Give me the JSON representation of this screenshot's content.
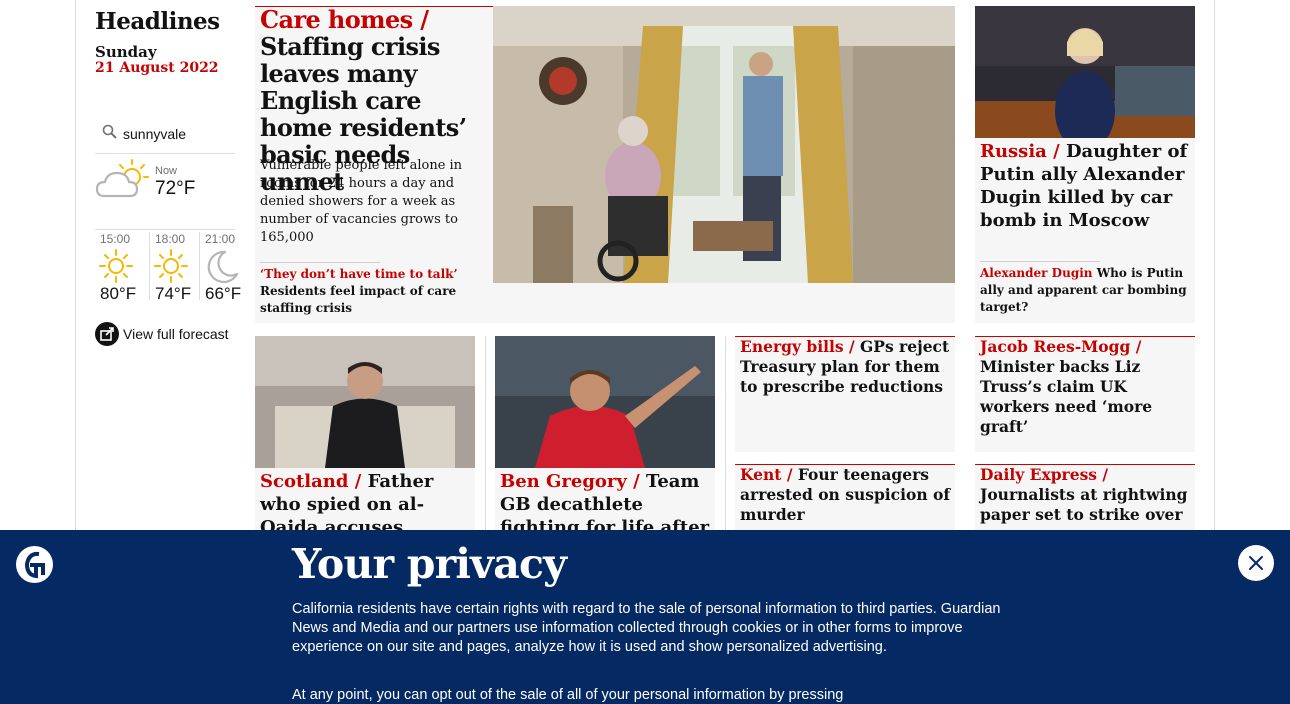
{
  "sidebar": {
    "section_title": "Headlines",
    "day": "Sunday",
    "date": "21 August 2022",
    "weather": {
      "location": "sunnyvale",
      "now_label": "Now",
      "now_temp": "72°F",
      "now_icon": "partly-cloudy-icon",
      "forecast": [
        {
          "time": "15:00",
          "temp": "80°F",
          "icon": "sun-icon"
        },
        {
          "time": "18:00",
          "temp": "74°F",
          "icon": "sun-icon"
        },
        {
          "time": "21:00",
          "temp": "66°F",
          "icon": "moon-icon"
        }
      ],
      "full_forecast_label": "View full forecast"
    }
  },
  "main_story": {
    "kicker": "Care homes /",
    "headline": "Staffing crisis leaves many English care home residents’ basic needs unmet",
    "standfirst": "Vulnerable people left alone in rooms for 24 hours a day and denied showers for a week as number of vacancies grows to 165,000",
    "sublink_kicker": "‘They don’t have time to talk’",
    "sublink_text": "Residents feel impact of care staffing crisis"
  },
  "russia_story": {
    "kicker": "Russia /",
    "headline": "Daughter of Putin ally Alexander Dugin killed by car bomb in Moscow",
    "sublink_kicker": "Alexander Dugin",
    "sublink_text": "Who is Putin ally and apparent car bombing target?"
  },
  "scotland_story": {
    "kicker": "Scotland /",
    "headline": "Father who spied on al-Qaida accuses Edinburgh"
  },
  "gregory_story": {
    "kicker": "Ben Gregory /",
    "headline": "Team GB decathlete fighting for life after bike crash"
  },
  "energy_story": {
    "kicker": "Energy bills /",
    "headline": "GPs reject Treasury plan for them to prescribe reductions"
  },
  "rees_mogg_story": {
    "kicker": "Jacob Rees-Mogg /",
    "headline": "Minister backs Liz Truss’s claim UK workers need ‘more graft’"
  },
  "kent_story": {
    "kicker": "Kent /",
    "headline": "Four teenagers arrested on suspicion of murder"
  },
  "express_story": {
    "kicker": "Daily Express /",
    "headline": "Journalists at rightwing paper set to strike over pay"
  },
  "privacy": {
    "title": "Your privacy",
    "body": "California residents have certain rights with regard to the sale of personal information to third parties. Guardian News and Media and our partners use information collected through cookies or in other forms to improve experience on our site and pages, analyze how it is used and show personalized advertising.",
    "body2": "At any point, you can opt out of the sale of all of your personal information by pressing"
  },
  "colors": {
    "accent_red": "#c70000",
    "brand_blue": "#052962",
    "card_bg": "#f6f6f6"
  }
}
